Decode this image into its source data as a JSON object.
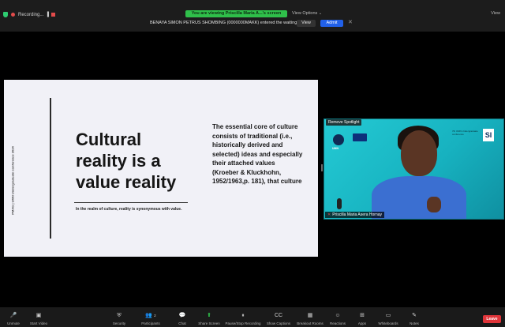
{
  "top_bar": {
    "recording_label": "Recording...",
    "viewing_banner": "You are viewing Priscilla Maria A...'s screen",
    "view_options": "View Options",
    "view_options_chevron": "⌄",
    "view_mode": "View",
    "waiting_notice": "BENAYA SIMON PETRUS SHOMBING (0000000MAKK) entered the waiting room",
    "view_button": "View",
    "admit_button": "Admit",
    "close_glyph": "✕"
  },
  "slide": {
    "title": "Cultural reality is a value reality",
    "subtitle": "In the realm of culture, reality is synonymous with value.",
    "body": "The essential core of culture consists of traditional (i.e., historically derived and selected) ideas and especially their attached values (Kroeber & Kluckhohn, 1952/1963,p. 181), that culture",
    "side_text": "PMAG | UMN Undergraduate conference 2024"
  },
  "video": {
    "remove_spotlight": "Remove Spotlight",
    "participant_name": "Priscilla Maria Asera Hornay",
    "si_logo": "SI",
    "logo_caption": "UMN",
    "banner_text": "7th UMN Undergraduate conference"
  },
  "toolbar": {
    "items": [
      {
        "label": "Unmute",
        "icon": "🎤"
      },
      {
        "label": "Start Video",
        "icon": "▣"
      },
      {
        "label": "Security",
        "icon": "⛨"
      },
      {
        "label": "Participants",
        "icon": "👥"
      },
      {
        "label": "Chat",
        "icon": "💬"
      },
      {
        "label": "Share Screen",
        "icon": "⬆"
      },
      {
        "label": "Pause/Stop Recording",
        "icon": "⏸"
      },
      {
        "label": "Show Captions",
        "icon": "CC"
      },
      {
        "label": "Breakout Rooms",
        "icon": "▦"
      },
      {
        "label": "Reactions",
        "icon": "☺"
      },
      {
        "label": "Apps",
        "icon": "⊞"
      },
      {
        "label": "Whiteboards",
        "icon": "▭"
      },
      {
        "label": "Notes",
        "icon": "✎"
      }
    ],
    "participant_count": "2",
    "leave": "Leave"
  },
  "colors": {
    "accent_green": "#2fbf4a",
    "admit_blue": "#2160e8",
    "leave_red": "#e0353a"
  }
}
